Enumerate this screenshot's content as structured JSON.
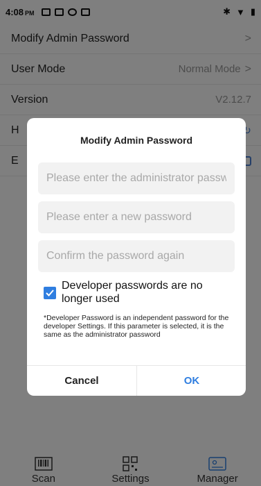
{
  "status_bar": {
    "time": "4:08",
    "ampm": "PM"
  },
  "settings_list": {
    "rows": [
      {
        "label": "Modify Admin Password",
        "value": ""
      },
      {
        "label": "User Mode",
        "value": "Normal Mode"
      },
      {
        "label": "Version",
        "value": "V2.12.7"
      },
      {
        "label": "H",
        "value": ""
      },
      {
        "label": "E",
        "value": ""
      }
    ]
  },
  "dialog": {
    "title": "Modify Admin Password",
    "admin_placeholder": "Please enter the administrator password",
    "new_placeholder": "Please enter a new password",
    "confirm_placeholder": "Confirm the password again",
    "checkbox_label": "Developer passwords are no longer used",
    "checkbox_checked": true,
    "note": "*Developer Password is an independent password for the developer Settings. If this parameter is selected, it is the same as the administrator password",
    "cancel_label": "Cancel",
    "ok_label": "OK",
    "accent_color": "#2f7ee0"
  },
  "bottom_nav": {
    "items": [
      {
        "label": "Scan",
        "icon": "barcode-icon"
      },
      {
        "label": "Settings",
        "icon": "qr-code-icon"
      },
      {
        "label": "Manager",
        "icon": "id-card-icon"
      }
    ]
  }
}
